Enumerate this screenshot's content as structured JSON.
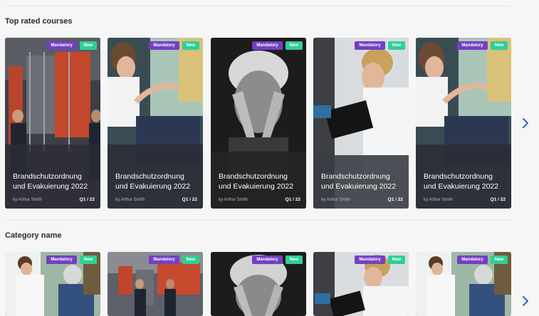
{
  "sections": {
    "top_rated": {
      "title": "Top rated courses"
    },
    "category": {
      "title": "Category name"
    }
  },
  "course": {
    "badge_mandatory": "Mandatory",
    "badge_new": "New",
    "title": "Brandschutzordnung und Evakuierung 2022",
    "author": "by Arthur Smith",
    "term": "Q1 / 22"
  },
  "icons": {
    "next": "chevron-right-icon"
  },
  "colors": {
    "mandatory": "#7340c2",
    "new": "#2fcf95",
    "chevron": "#3b5ec2"
  }
}
